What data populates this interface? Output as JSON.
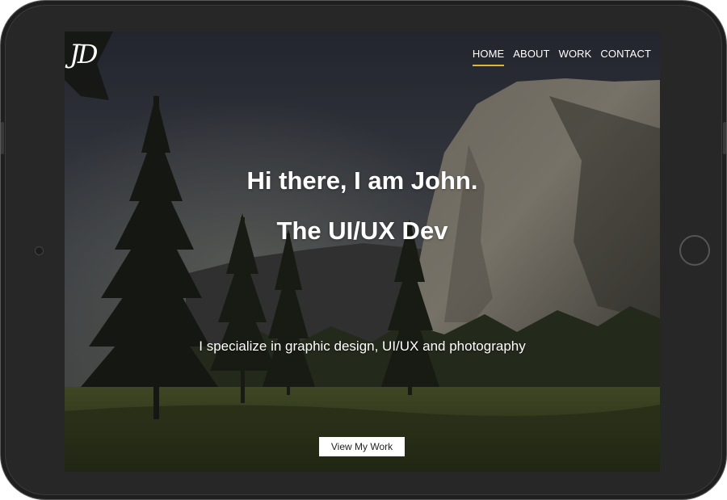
{
  "site": {
    "logo_text": "JD"
  },
  "nav": {
    "items": [
      {
        "label": "HOME",
        "active": true
      },
      {
        "label": "ABOUT",
        "active": false
      },
      {
        "label": "WORK",
        "active": false
      },
      {
        "label": "CONTACT",
        "active": false
      }
    ],
    "active_underline_color": "#e0b630"
  },
  "hero": {
    "title_line1": "Hi there, I am John.",
    "title_line2": "The UI/UX Dev",
    "subtitle": "I specialize in graphic design, UI/UX and photography",
    "cta_label": "View My Work"
  },
  "device": {
    "frame_color": "#272727",
    "icons": [
      "front-camera-icon",
      "home-button-icon"
    ]
  }
}
